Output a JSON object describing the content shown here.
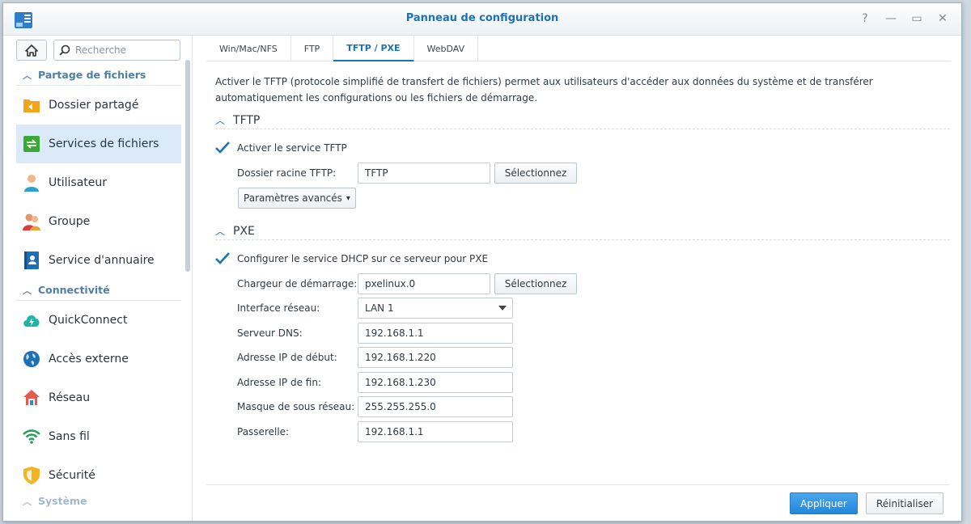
{
  "window": {
    "title": "Panneau de configuration"
  },
  "search": {
    "placeholder": "Recherche"
  },
  "sidebar": {
    "sections": [
      {
        "label": "Partage de fichiers",
        "items": [
          "Dossier partagé",
          "Services de fichiers",
          "Utilisateur",
          "Groupe",
          "Service d'annuaire"
        ]
      },
      {
        "label": "Connectivité",
        "items": [
          "QuickConnect",
          "Accès externe",
          "Réseau",
          "Sans fil",
          "Sécurité"
        ]
      },
      {
        "label": "Système"
      }
    ],
    "active_item": "Services de fichiers"
  },
  "tabs": [
    "Win/Mac/NFS",
    "FTP",
    "TFTP / PXE",
    "WebDAV"
  ],
  "active_tab": "TFTP / PXE",
  "description": "Activer le TFTP (protocole simplifié de transfert de fichiers) permet aux utilisateurs d'accéder aux données du système et de transférer automatiquement les configurations ou les fichiers de démarrage.",
  "tftp": {
    "heading": "TFTP",
    "enable_label": "Activer le service TFTP",
    "enabled": true,
    "root_label": "Dossier racine TFTP:",
    "root_value": "TFTP",
    "select_button": "Sélectionnez",
    "advanced_button": "Paramètres avancés"
  },
  "pxe": {
    "heading": "PXE",
    "dhcp_label": "Configurer le service DHCP sur ce serveur pour PXE",
    "dhcp_enabled": true,
    "boot_loader_label": "Chargeur de démarrage:",
    "boot_loader_value": "pxelinux.0",
    "select_button": "Sélectionnez",
    "interface_label": "Interface réseau:",
    "interface_value": "LAN 1",
    "dns_label": "Serveur DNS:",
    "dns_value": "192.168.1.1",
    "start_ip_label": "Adresse IP de début:",
    "start_ip_value": "192.168.1.220",
    "end_ip_label": "Adresse IP de fin:",
    "end_ip_value": "192.168.1.230",
    "mask_label": "Masque de sous réseau:",
    "mask_value": "255.255.255.0",
    "gateway_label": "Passerelle:",
    "gateway_value": "192.168.1.1"
  },
  "footer": {
    "apply": "Appliquer",
    "reset": "Réinitialiser"
  },
  "colors": {
    "accent": "#1a73b8",
    "active_bg": "#dbeaf8",
    "primary_button": "#2188d9"
  }
}
